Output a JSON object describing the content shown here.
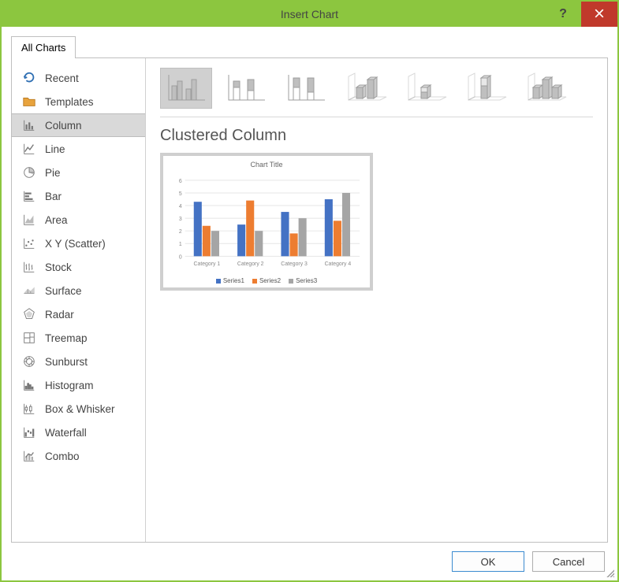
{
  "window": {
    "title": "Insert Chart",
    "help_tooltip": "?",
    "close_tooltip": "×"
  },
  "tabs": [
    {
      "label": "All Charts",
      "selected": true
    }
  ],
  "sidebar": {
    "items": [
      {
        "key": "recent",
        "label": "Recent",
        "icon": "recent-icon"
      },
      {
        "key": "templates",
        "label": "Templates",
        "icon": "folder-icon"
      },
      {
        "key": "column",
        "label": "Column",
        "icon": "column-chart-icon",
        "selected": true
      },
      {
        "key": "line",
        "label": "Line",
        "icon": "line-chart-icon"
      },
      {
        "key": "pie",
        "label": "Pie",
        "icon": "pie-chart-icon"
      },
      {
        "key": "bar",
        "label": "Bar",
        "icon": "bar-chart-icon"
      },
      {
        "key": "area",
        "label": "Area",
        "icon": "area-chart-icon"
      },
      {
        "key": "xy",
        "label": "X Y (Scatter)",
        "icon": "scatter-chart-icon"
      },
      {
        "key": "stock",
        "label": "Stock",
        "icon": "stock-chart-icon"
      },
      {
        "key": "surface",
        "label": "Surface",
        "icon": "surface-chart-icon"
      },
      {
        "key": "radar",
        "label": "Radar",
        "icon": "radar-chart-icon"
      },
      {
        "key": "treemap",
        "label": "Treemap",
        "icon": "treemap-chart-icon"
      },
      {
        "key": "sunburst",
        "label": "Sunburst",
        "icon": "sunburst-chart-icon"
      },
      {
        "key": "histogram",
        "label": "Histogram",
        "icon": "histogram-chart-icon"
      },
      {
        "key": "boxwhisker",
        "label": "Box & Whisker",
        "icon": "boxwhisker-chart-icon"
      },
      {
        "key": "waterfall",
        "label": "Waterfall",
        "icon": "waterfall-chart-icon"
      },
      {
        "key": "combo",
        "label": "Combo",
        "icon": "combo-chart-icon"
      }
    ]
  },
  "subtypes": {
    "selected_index": 0,
    "names": [
      "clustered-column",
      "stacked-column",
      "100-stacked-column",
      "3d-clustered-column",
      "3d-stacked-column",
      "3d-100-stacked-column",
      "3d-column"
    ]
  },
  "subtype_title": "Clustered Column",
  "preview": {
    "title": "Chart Title",
    "legend": [
      "Series1",
      "Series2",
      "Series3"
    ]
  },
  "buttons": {
    "ok": "OK",
    "cancel": "Cancel"
  },
  "colors": {
    "accent": "#8cc63f",
    "close": "#c0392b",
    "series1": "#4472c4",
    "series2": "#ed7d31",
    "series3": "#a5a5a5"
  },
  "chart_data": {
    "type": "bar",
    "title": "Chart Title",
    "xlabel": "",
    "ylabel": "",
    "ylim": [
      0,
      6
    ],
    "categories": [
      "Category 1",
      "Category 2",
      "Category 3",
      "Category 4"
    ],
    "series": [
      {
        "name": "Series1",
        "color": "#4472c4",
        "values": [
          4.3,
          2.5,
          3.5,
          4.5
        ]
      },
      {
        "name": "Series2",
        "color": "#ed7d31",
        "values": [
          2.4,
          4.4,
          1.8,
          2.8
        ]
      },
      {
        "name": "Series3",
        "color": "#a5a5a5",
        "values": [
          2.0,
          2.0,
          3.0,
          5.0
        ]
      }
    ]
  }
}
